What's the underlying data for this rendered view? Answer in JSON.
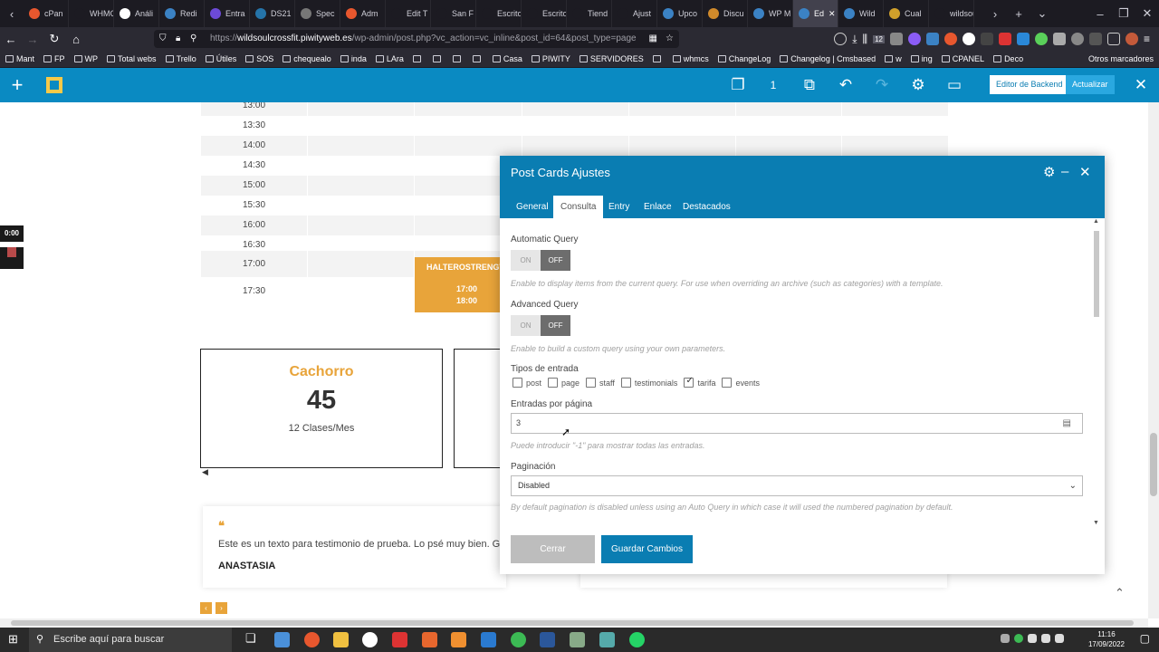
{
  "browser": {
    "tabs": [
      {
        "label": "cPan",
        "color": "#e8572e"
      },
      {
        "label": "WHMCS",
        "color": "#1c1b22"
      },
      {
        "label": "Análi",
        "color": "#ffffff"
      },
      {
        "label": "Redi",
        "color": "#3b82c4"
      },
      {
        "label": "Entra",
        "color": "#6c4ad6"
      },
      {
        "label": "DS21",
        "color": "#2574a9"
      },
      {
        "label": "Spec",
        "color": "#777777"
      },
      {
        "label": "Adm",
        "color": "#e8572e"
      },
      {
        "label": "Edit T",
        "color": "#1c1b22"
      },
      {
        "label": "San F",
        "color": "#1c1b22"
      },
      {
        "label": "Escritorio",
        "color": "#1c1b22"
      },
      {
        "label": "Escritorio",
        "color": "#1c1b22"
      },
      {
        "label": "Tiend",
        "color": "#1c1b22"
      },
      {
        "label": "Ajust",
        "color": "#1c1b22"
      },
      {
        "label": "Upco",
        "color": "#3b82c4"
      },
      {
        "label": "Discu",
        "color": "#d08a2b"
      },
      {
        "label": "WP M",
        "color": "#3b82c4"
      },
      {
        "label": "Ed",
        "color": "#3b82c4",
        "active": true
      },
      {
        "label": "Wild",
        "color": "#3b82c4"
      },
      {
        "label": "Cual",
        "color": "#d0a02b"
      },
      {
        "label": "wildsoulc",
        "color": "#1c1b22"
      }
    ],
    "url_prefix": "https://",
    "url_domain": "wildsoulcrossfit.piwityweb.es",
    "url_path": "/wp-admin/post.php?vc_action=vc_inline&post_id=64&post_type=page",
    "badge": "12",
    "bookmarks": [
      "Mant",
      "FP",
      "WP",
      "Total webs",
      "Trello",
      "Útiles",
      "SOS",
      "chequealo",
      "inda",
      "LAra",
      "",
      "",
      "",
      "",
      "Casa",
      "PIWITY",
      "SERVIDORES",
      "",
      "whmcs",
      "ChangeLog",
      "Changelog | Cmsbased",
      "w",
      "ing",
      "CPANEL",
      "Deco"
    ],
    "other_bookmarks": "Otros marcadores"
  },
  "vc_toolbar": {
    "count": "1",
    "backend_btn": "Editor de Backend",
    "update_btn": "Actualizar"
  },
  "schedule": {
    "times": [
      "13:00",
      "13:30",
      "14:00",
      "14:30",
      "15:00",
      "15:30",
      "16:00",
      "16:30",
      "17:00",
      "17:30"
    ],
    "event_title": "HALTEROSTRENGT",
    "event_start": "17:00",
    "event_end": "18:00"
  },
  "card": {
    "title": "Cachorro",
    "price": "45",
    "subtitle": "12 Clases/Mes"
  },
  "testimonial": {
    "text": "Este es un texto para testimonio de prueba. Lo psé muy bien. Grac",
    "author": "ANASTASIA"
  },
  "recorder": {
    "time": "0:00"
  },
  "modal": {
    "title": "Post Cards Ajustes",
    "tabs": [
      "General",
      "Consulta",
      "Entry",
      "Enlace",
      "Destacados"
    ],
    "active_tab": "Consulta",
    "automatic_query": {
      "label": "Automatic Query",
      "on": "ON",
      "off": "OFF",
      "hint": "Enable to display items from the current query. For use when overriding an archive (such as categories) with a template."
    },
    "advanced_query": {
      "label": "Advanced Query",
      "on": "ON",
      "off": "OFF",
      "hint": "Enable to build a custom query using your own parameters."
    },
    "post_types": {
      "label": "Tipos de entrada",
      "options": [
        {
          "label": "post",
          "checked": false
        },
        {
          "label": "page",
          "checked": false
        },
        {
          "label": "staff",
          "checked": false
        },
        {
          "label": "testimonials",
          "checked": false
        },
        {
          "label": "tarifa",
          "checked": true
        },
        {
          "label": "events",
          "checked": false
        }
      ]
    },
    "per_page": {
      "label": "Entradas por página",
      "value": "3",
      "hint": "Puede introducir \"-1\" para mostrar todas las entradas."
    },
    "pagination": {
      "label": "Paginación",
      "value": "Disabled",
      "hint": "By default pagination is disabled unless using an Auto Query in which case it will used the numbered pagination by default."
    },
    "close_btn": "Cerrar",
    "save_btn": "Guardar Cambios"
  },
  "taskbar": {
    "search_placeholder": "Escribe aquí para buscar",
    "time": "11:16",
    "date": "17/09/2022"
  },
  "colors": {
    "accent": "#0a7db2",
    "event": "#e8a43a",
    "card_title": "#e8a43a"
  }
}
